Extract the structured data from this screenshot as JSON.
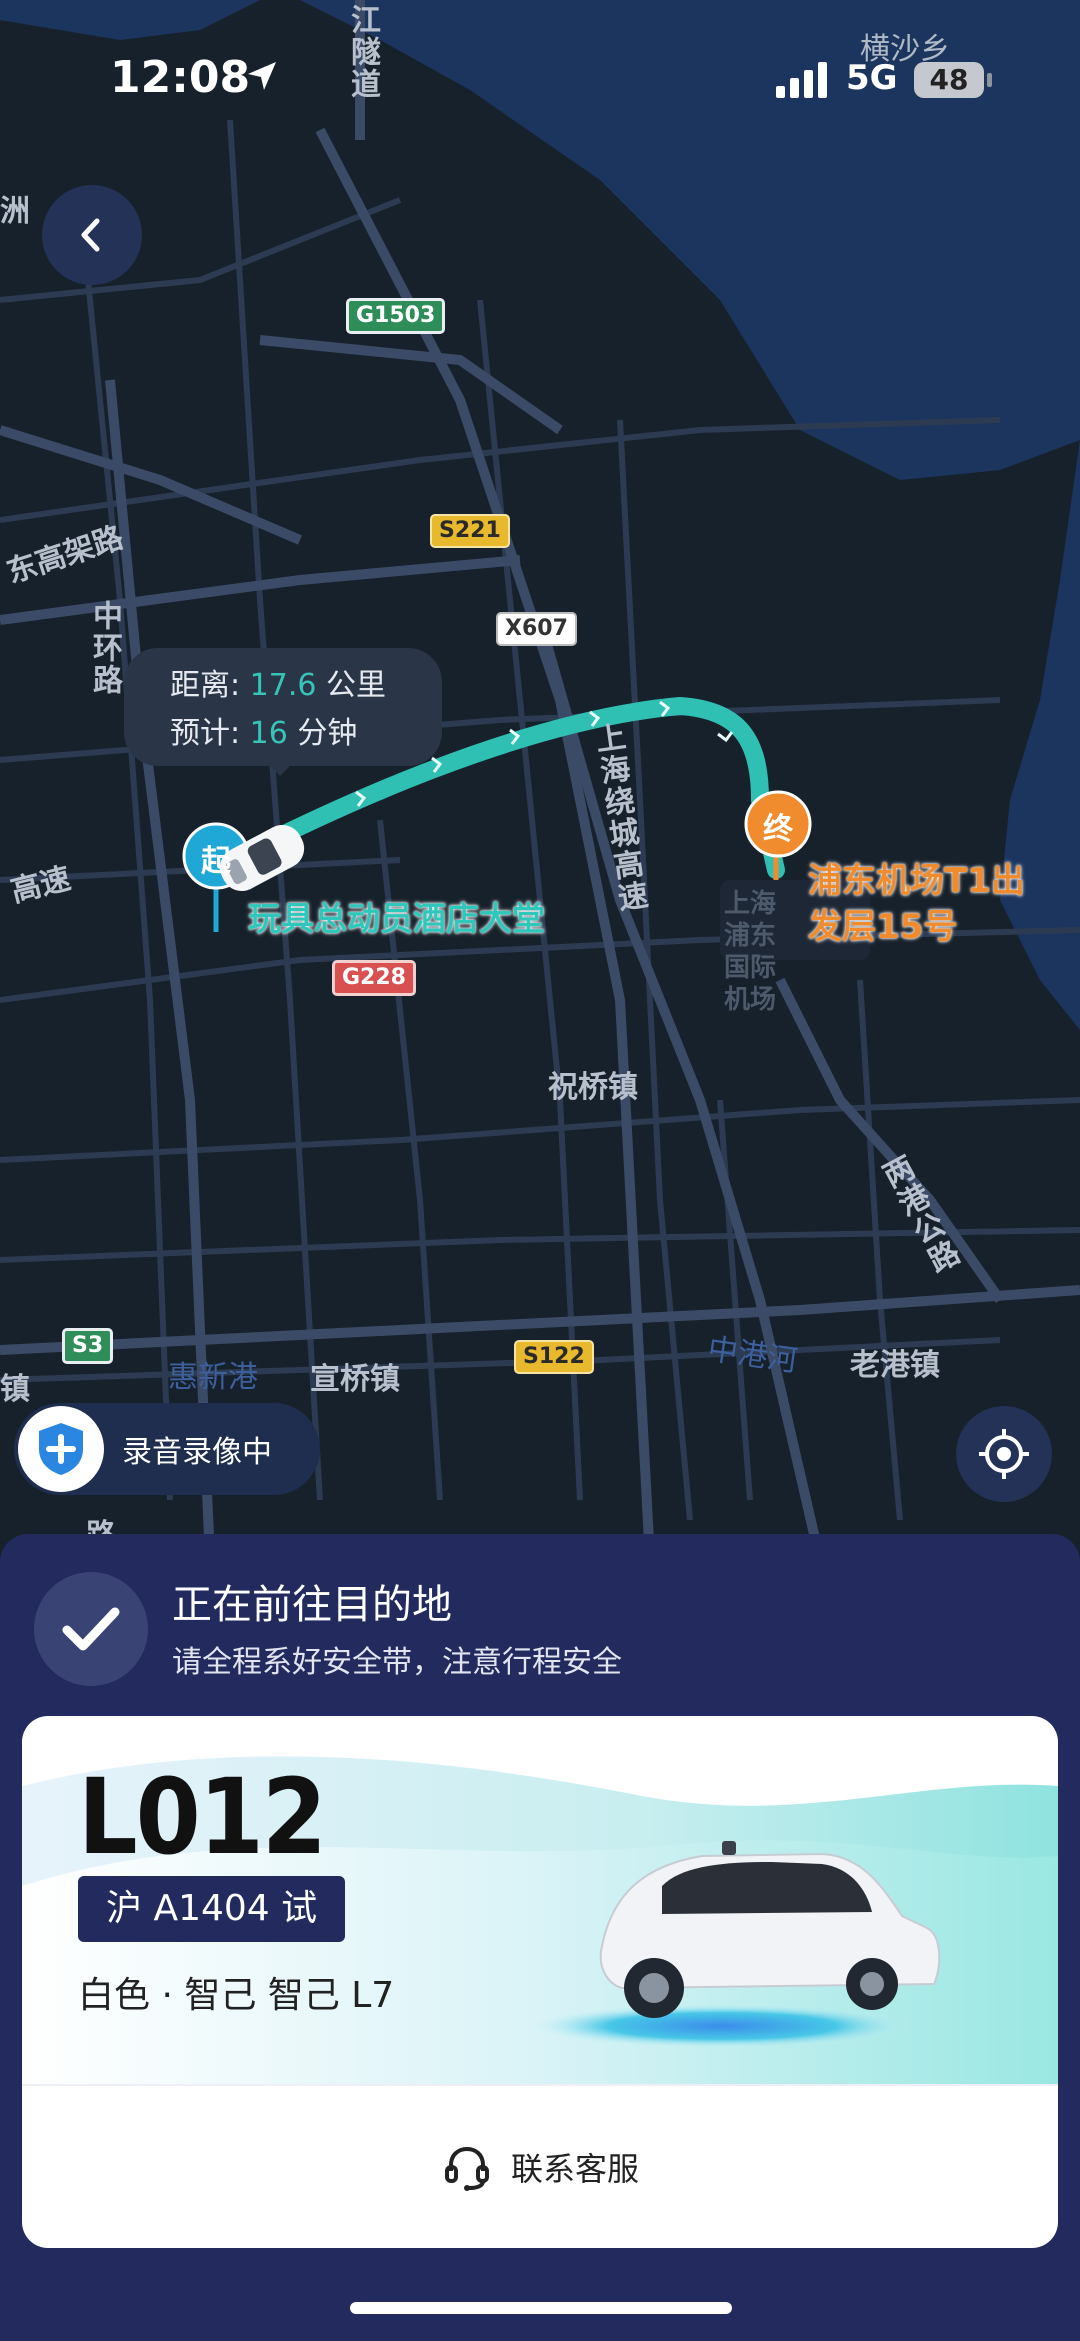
{
  "status_bar": {
    "time": "12:08",
    "network": "5G",
    "battery": "48",
    "location_label": "横沙乡"
  },
  "map": {
    "place_labels": [
      {
        "text": "洲",
        "key": "p1"
      },
      {
        "text": "东高架路",
        "key": "p2"
      },
      {
        "text": "中环路",
        "key": "p3"
      },
      {
        "text": "高速",
        "key": "p4"
      },
      {
        "text": "上海绕城高速",
        "key": "p5"
      },
      {
        "text": "祝桥镇",
        "key": "p6"
      },
      {
        "text": "两港公路",
        "key": "p7"
      },
      {
        "text": "宣桥镇",
        "key": "p8"
      },
      {
        "text": "老港镇",
        "key": "p9"
      },
      {
        "text": "江隧道",
        "key": "p10"
      },
      {
        "text": "上海浦东国际机场",
        "key": "p11"
      },
      {
        "text": "镇",
        "key": "p12"
      },
      {
        "text": "路",
        "key": "p13"
      }
    ],
    "water_labels": [
      "惠新港",
      "中港河"
    ],
    "road_shields": [
      "G1503",
      "S221",
      "X607",
      "G228",
      "S3",
      "S122"
    ],
    "route_info": {
      "distance_label": "距离:",
      "distance_value": "17.6",
      "distance_unit": "公里",
      "eta_label": "预计:",
      "eta_value": "16",
      "eta_unit": "分钟"
    },
    "start_marker": "起",
    "end_marker": "终",
    "start_place": "玩具总动员酒店大堂",
    "end_place_line1": "浦东机场T1出",
    "end_place_line2": "发层15号",
    "recording_text": "录音录像中"
  },
  "trip_status": {
    "title": "正在前往目的地",
    "subtitle": "请全程系好安全带，注意行程安全"
  },
  "vehicle": {
    "id": "L012",
    "plate": "沪 A1404 试",
    "description": "白色 · 智己 智己 L7",
    "contact_label": "联系客服"
  },
  "colors": {
    "route": "#2fbfb3",
    "start": "#1fa8d6",
    "end": "#f08c2e",
    "panel": "#222a5e"
  }
}
